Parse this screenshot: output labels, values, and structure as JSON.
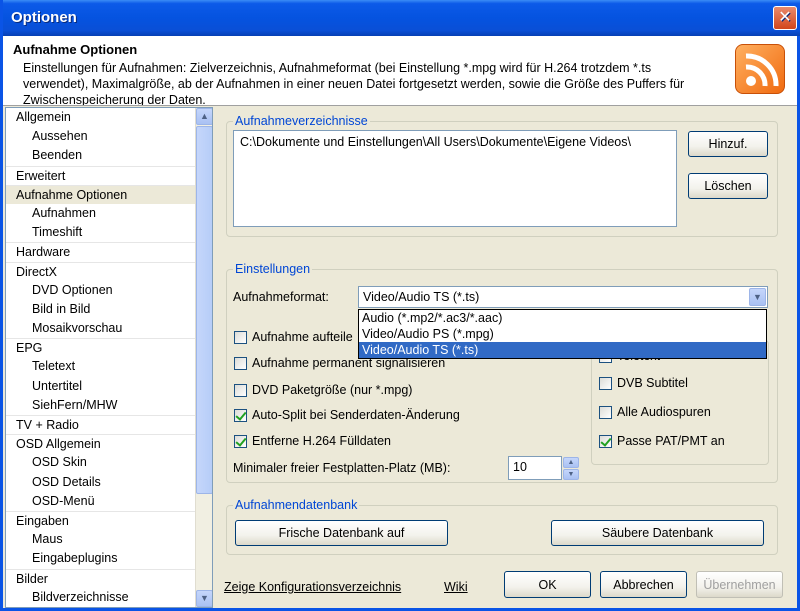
{
  "window": {
    "title": "Optionen",
    "close": "✕"
  },
  "header": {
    "title": "Aufnahme Optionen",
    "description": "Einstellungen für Aufnahmen: Zielverzeichnis, Aufnahmeformat (bei Einstellung *.mpg wird für H.264 trotzdem *.ts verwendet), Maximalgröße, ab der Aufnahmen in einer neuen Datei fortgesetzt werden, sowie die Größe des Puffers für Zwischenspeicherung der Daten."
  },
  "tree": {
    "items": [
      {
        "label": "Allgemein",
        "level": 0
      },
      {
        "label": "Aussehen",
        "level": 1
      },
      {
        "label": "Beenden",
        "level": 1
      },
      {
        "label": "Erweitert",
        "level": 0
      },
      {
        "label": "Aufnahme Optionen",
        "level": 0,
        "selected": true
      },
      {
        "label": "Aufnahmen",
        "level": 1
      },
      {
        "label": "Timeshift",
        "level": 1
      },
      {
        "label": "Hardware",
        "level": 0
      },
      {
        "label": "DirectX",
        "level": 0
      },
      {
        "label": "DVD Optionen",
        "level": 1
      },
      {
        "label": "Bild in Bild",
        "level": 1
      },
      {
        "label": "Mosaikvorschau",
        "level": 1
      },
      {
        "label": "EPG",
        "level": 0
      },
      {
        "label": "Teletext",
        "level": 1
      },
      {
        "label": "Untertitel",
        "level": 1
      },
      {
        "label": "SiehFern/MHW",
        "level": 1
      },
      {
        "label": "TV + Radio",
        "level": 0
      },
      {
        "label": "OSD Allgemein",
        "level": 0
      },
      {
        "label": "OSD Skin",
        "level": 1
      },
      {
        "label": "OSD Details",
        "level": 1
      },
      {
        "label": "OSD-Menü",
        "level": 1
      },
      {
        "label": "Eingaben",
        "level": 0
      },
      {
        "label": "Maus",
        "level": 1
      },
      {
        "label": "Eingabeplugins",
        "level": 1
      },
      {
        "label": "Bilder",
        "level": 0
      },
      {
        "label": "Bildverzeichnisse",
        "level": 1
      }
    ]
  },
  "dirs": {
    "group_label": "Aufnahmeverzeichnisse",
    "entries": [
      "C:\\Dokumente und Einstellungen\\All Users\\Dokumente\\Eigene Videos\\"
    ],
    "add_label": "Hinzuf.",
    "remove_label": "Löschen"
  },
  "settings": {
    "group_label": "Einstellungen",
    "format_label": "Aufnahmeformat:",
    "format_value": "Video/Audio TS (*.ts)",
    "format_options": [
      "Audio  (*.mp2/*.ac3/*.aac)",
      "Video/Audio PS  (*.mpg)",
      "Video/Audio TS (*.ts)"
    ],
    "checks_left": [
      {
        "label": "Aufnahme aufteile",
        "checked": false
      },
      {
        "label": "Aufnahme permanent signalisieren",
        "checked": false
      },
      {
        "label": "DVD Paketgröße (nur *.mpg)",
        "checked": false
      },
      {
        "label": "Auto-Split bei Senderdaten-Änderung",
        "checked": true
      },
      {
        "label": "Entferne H.264 Fülldaten",
        "checked": true
      }
    ],
    "checks_right": [
      {
        "label": "Teletext",
        "checked": false
      },
      {
        "label": "DVB Subtitel",
        "checked": false
      },
      {
        "label": "Alle Audiospuren",
        "checked": false
      },
      {
        "label": "Passe PAT/PMT an",
        "checked": true
      }
    ],
    "minspace_label": "Minimaler freier Festplatten-Platz (MB):",
    "minspace_value": "10"
  },
  "db": {
    "group_label": "Aufnahmendatenbank",
    "refresh_label": "Frische Datenbank auf",
    "clean_label": "Säubere Datenbank"
  },
  "footer": {
    "config_link": "Zeige Konfigurationsverzeichnis",
    "wiki_link": "Wiki",
    "ok_label": "OK",
    "cancel_label": "Abbrechen",
    "apply_label": "Übernehmen"
  }
}
